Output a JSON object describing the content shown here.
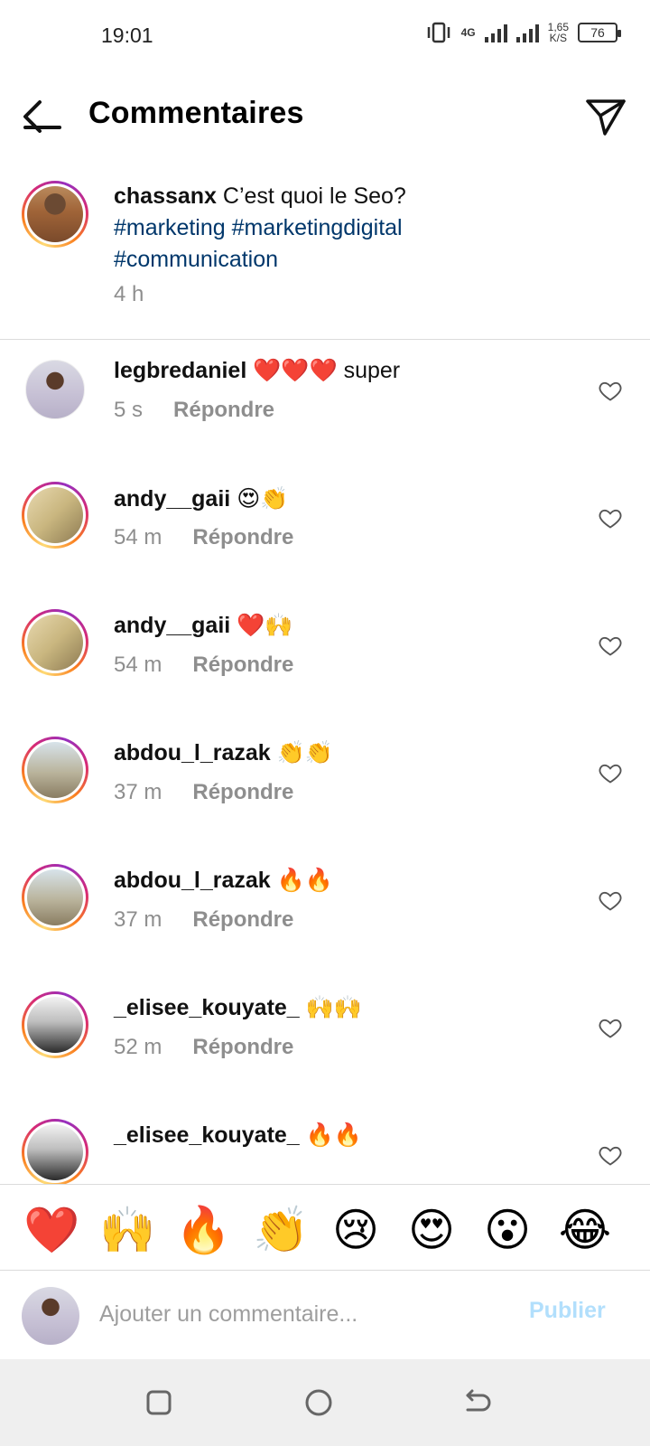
{
  "status_bar": {
    "time": "19:01",
    "network": "4G",
    "speed_value": "1,65",
    "speed_unit": "K/S",
    "battery": "76"
  },
  "header": {
    "title": "Commentaires",
    "back_icon": "arrow-left-icon",
    "share_icon": "paper-plane-icon"
  },
  "caption": {
    "username": "chassanx",
    "text": "C’est quoi le Seo?",
    "hashtags": [
      "#marketing",
      "#marketingdigital",
      "#communication"
    ],
    "time": "4 h"
  },
  "comments": [
    {
      "username": "legbredaniel",
      "emoji": "❤️❤️❤️",
      "text": "super",
      "time": "5 s",
      "reply": "Répondre"
    },
    {
      "username": "andy__gaii",
      "emoji": "😍👏",
      "text": "",
      "time": "54 m",
      "reply": "Répondre"
    },
    {
      "username": "andy__gaii",
      "emoji": "❤️🙌",
      "text": "",
      "time": "54 m",
      "reply": "Répondre"
    },
    {
      "username": "abdou_l_razak",
      "emoji": "👏👏",
      "text": "",
      "time": "37 m",
      "reply": "Répondre"
    },
    {
      "username": "abdou_l_razak",
      "emoji": "🔥🔥",
      "text": "",
      "time": "37 m",
      "reply": "Répondre"
    },
    {
      "username": "_elisee_kouyate_",
      "emoji": "🙌🙌",
      "text": "",
      "time": "52 m",
      "reply": "Répondre"
    },
    {
      "username": "_elisee_kouyate_",
      "emoji": "🔥🔥",
      "text": "",
      "time": "",
      "reply": ""
    }
  ],
  "quick_reactions": [
    "❤️",
    "🙌",
    "🔥",
    "👏",
    "😢",
    "😍",
    "😮",
    "😂"
  ],
  "composer": {
    "placeholder": "Ajouter un commentaire...",
    "publish_label": "Publier"
  },
  "colors": {
    "hashtag": "#00376b",
    "meta_gray": "#8e8e8e",
    "publish_disabled": "#b2dffc",
    "divider": "#dbdbdb"
  }
}
